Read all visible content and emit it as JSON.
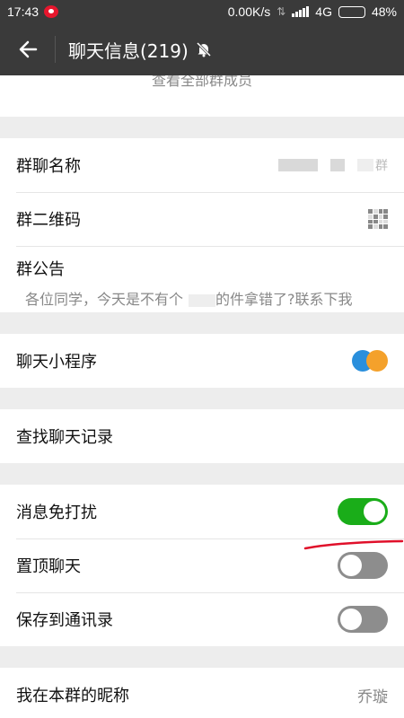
{
  "status_bar": {
    "time": "17:43",
    "net_speed": "0.00K/s",
    "network": "4G",
    "battery": "48%",
    "battery_level": 0.48
  },
  "header": {
    "title": "聊天信息(219)"
  },
  "top_cut_text": "查看全部群成员",
  "group_info": {
    "name_label": "群聊名称",
    "name_value_suffix": "群",
    "qrcode_label": "群二维码",
    "notice_label": "群公告",
    "notice_text_a": "各位同学，今天是不有个",
    "notice_text_b": "的件拿错了?联系下我"
  },
  "mini_program": {
    "label": "聊天小程序"
  },
  "search_history": {
    "label": "查找聊天记录"
  },
  "settings": {
    "mute_label": "消息免打扰",
    "mute_on": true,
    "pin_label": "置顶聊天",
    "pin_on": false,
    "save_label": "保存到通讯录",
    "save_on": false
  },
  "nickname": {
    "label": "我在本群的昵称",
    "value": "乔璇"
  },
  "colors": {
    "toggle_on": "#1aad19",
    "annotation": "#e0102a",
    "header_bg": "#3a3a3a"
  }
}
